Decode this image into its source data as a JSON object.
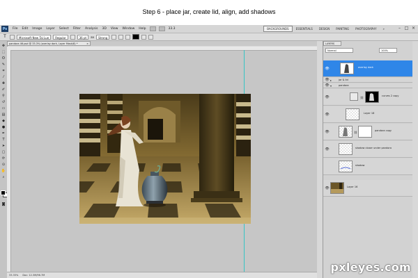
{
  "caption": "Step 6 - place jar, create lid, align, add shadows",
  "app": {
    "logo": "Ps",
    "menu": [
      "File",
      "Edit",
      "Image",
      "Layer",
      "Select",
      "Filter",
      "Analysis",
      "3D",
      "View",
      "Window",
      "Help"
    ],
    "zoom": "33.3",
    "workspaces": [
      "BACKGROUNDS",
      "ESSENTIALS",
      "DESIGN",
      "PAINTING",
      "PHOTOGRAPHY"
    ],
    "active_workspace": "BACKGROUNDS",
    "more": "»",
    "window_controls": [
      "–",
      "□",
      "×"
    ]
  },
  "options_bar": {
    "tool_icon": "T",
    "font_family": "Microsoft New Tai Lue",
    "font_style": "Regular",
    "font_size": "36 pt",
    "aa_label": "aa",
    "aa_mode": "Strong",
    "text_color": "#000000"
  },
  "document": {
    "tab_title": "pandora 46.psd @ 33.3% (overlay dark, Layer Mask/8) *",
    "close": "×"
  },
  "status": {
    "zoom": "33.33%",
    "doc_size": "Doc: 12.3M/96.7M"
  },
  "layers_panel": {
    "tab": "LAYERS",
    "blend_mode": "Normal",
    "opacity": "100%",
    "layers": [
      {
        "name": "overlay dark",
        "kind": "layer",
        "selected": true,
        "visible": true,
        "thumb": "figure-mask",
        "depth": 0
      },
      {
        "name": "jar & lid",
        "kind": "group",
        "selected": false,
        "visible": true,
        "depth": 0
      },
      {
        "name": "pandora",
        "kind": "group",
        "selected": false,
        "visible": true,
        "depth": 0
      },
      {
        "name": "curves 2 copy",
        "kind": "layer",
        "selected": false,
        "visible": true,
        "thumb": "curves-black",
        "depth": 2
      },
      {
        "name": "Layer 18",
        "kind": "layer",
        "selected": false,
        "visible": true,
        "thumb": "checker",
        "depth": 1
      },
      {
        "name": "pandora copy",
        "kind": "layer",
        "selected": false,
        "visible": true,
        "thumb": "figure-white",
        "depth": 1
      },
      {
        "name": "shadow closer under pandora",
        "kind": "layer",
        "selected": false,
        "visible": true,
        "thumb": "checker",
        "depth": 1
      },
      {
        "name": "shadow",
        "kind": "layer",
        "selected": false,
        "visible": false,
        "thumb": "checker-blue",
        "depth": 1
      },
      {
        "name": "Layer 16",
        "kind": "layer",
        "selected": false,
        "visible": true,
        "thumb": "scene",
        "depth": 0
      }
    ]
  },
  "watermark": "pxleyes.com",
  "colors": {
    "selection": "#2f86e8",
    "guide": "#35c4c4",
    "canvas_bg": "#c6c6c6",
    "art_base": "#6b5628"
  },
  "icons": {
    "eye": "eye-icon",
    "group_arrow": "disclosure-triangle-icon",
    "chain": "chain-link-icon"
  }
}
